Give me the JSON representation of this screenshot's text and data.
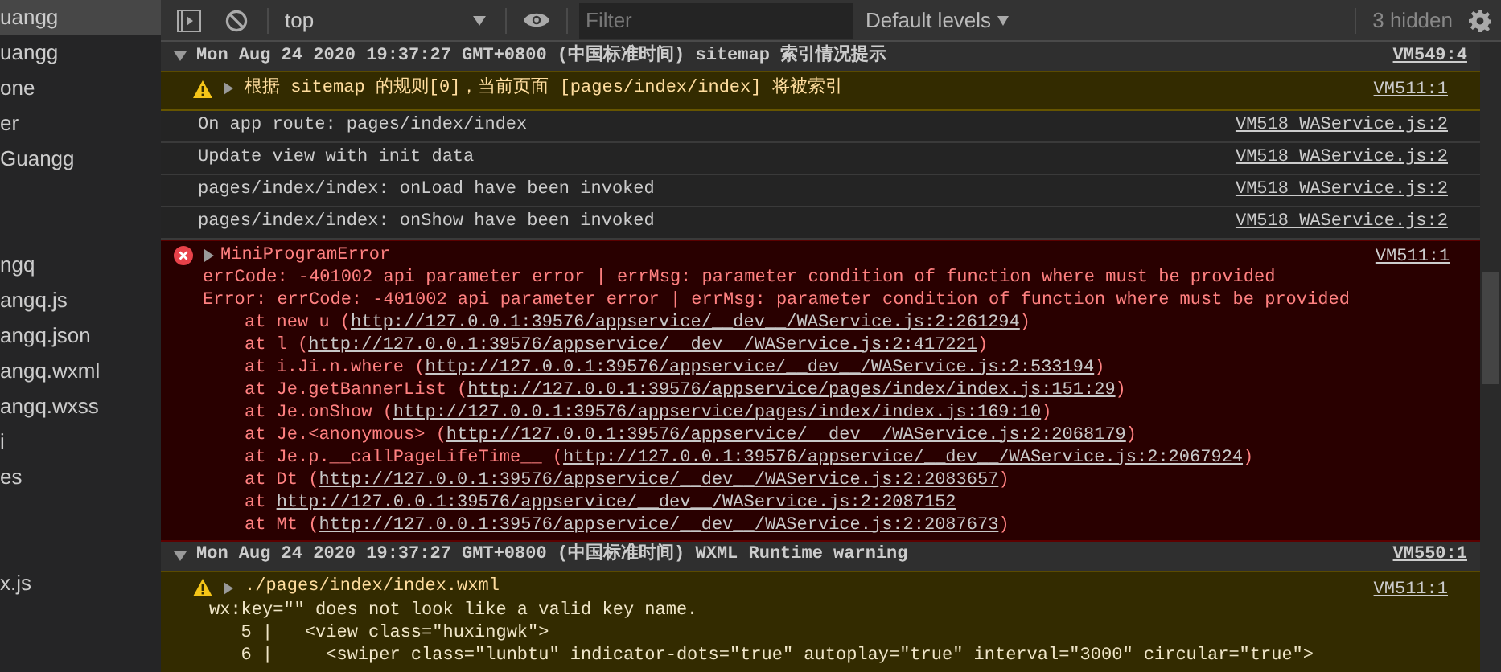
{
  "sidebar": {
    "items": [
      {
        "label": "uangg",
        "selected": true
      },
      {
        "label": "uangg",
        "selected": false
      },
      {
        "label": "one",
        "selected": false
      },
      {
        "label": "er",
        "selected": false
      },
      {
        "label": "Guangg",
        "selected": false
      },
      {
        "label": "ngq",
        "selected": false
      },
      {
        "label": "angq.js",
        "selected": false
      },
      {
        "label": "angq.json",
        "selected": false
      },
      {
        "label": "angq.wxml",
        "selected": false
      },
      {
        "label": "angq.wxss",
        "selected": false
      },
      {
        "label": "i",
        "selected": false
      },
      {
        "label": "es",
        "selected": false
      },
      {
        "label": "x.js",
        "selected": false
      }
    ]
  },
  "toolbar": {
    "context": "top",
    "filter": {
      "placeholder": "Filter"
    },
    "levels": "Default levels",
    "hidden_count": "3 hidden"
  },
  "messages": [
    {
      "kind": "group_header",
      "expanded": true,
      "text": "Mon Aug 24 2020 19:37:27 GMT+0800 (中国标准时间) sitemap 索引情况提示",
      "source": "VM549:4"
    },
    {
      "kind": "warning",
      "expanded": false,
      "text": "根据 sitemap 的规则[0]，当前页面 [pages/index/index] 将被索引",
      "source": "VM511:1"
    },
    {
      "kind": "log",
      "text": "On app route: pages/index/index",
      "source": "VM518 WAService.js:2"
    },
    {
      "kind": "log",
      "text": "Update view with init data",
      "source": "VM518 WAService.js:2"
    },
    {
      "kind": "log",
      "text": "pages/index/index: onLoad have been invoked",
      "source": "VM518 WAService.js:2"
    },
    {
      "kind": "log",
      "text": "pages/index/index: onShow have been invoked",
      "source": "VM518 WAService.js:2"
    },
    {
      "kind": "error",
      "expanded": false,
      "text": "MiniProgramError",
      "source": "VM511:1",
      "lines": [
        "errCode: -401002 api parameter error | errMsg: parameter condition of function where must be provided",
        "Error: errCode: -401002 api parameter error | errMsg: parameter condition of function where must be provided"
      ],
      "stack": [
        {
          "prefix": "at new u (",
          "url": "http://127.0.0.1:39576/appservice/__dev__/WAService.js:2:261294",
          "suffix": ")"
        },
        {
          "prefix": "at l (",
          "url": "http://127.0.0.1:39576/appservice/__dev__/WAService.js:2:417221",
          "suffix": ")"
        },
        {
          "prefix": "at i.Ji.n.where (",
          "url": "http://127.0.0.1:39576/appservice/__dev__/WAService.js:2:533194",
          "suffix": ")"
        },
        {
          "prefix": "at Je.getBannerList (",
          "url": "http://127.0.0.1:39576/appservice/pages/index/index.js:151:29",
          "suffix": ")"
        },
        {
          "prefix": "at Je.onShow (",
          "url": "http://127.0.0.1:39576/appservice/pages/index/index.js:169:10",
          "suffix": ")"
        },
        {
          "prefix": "at Je.<anonymous> (",
          "url": "http://127.0.0.1:39576/appservice/__dev__/WAService.js:2:2068179",
          "suffix": ")"
        },
        {
          "prefix": "at Je.p.__callPageLifeTime__ (",
          "url": "http://127.0.0.1:39576/appservice/__dev__/WAService.js:2:2067924",
          "suffix": ")"
        },
        {
          "prefix": "at Dt (",
          "url": "http://127.0.0.1:39576/appservice/__dev__/WAService.js:2:2083657",
          "suffix": ")"
        },
        {
          "prefix": "at ",
          "url": "http://127.0.0.1:39576/appservice/__dev__/WAService.js:2:2087152"
        },
        {
          "prefix": "at Mt (",
          "url": "http://127.0.0.1:39576/appservice/__dev__/WAService.js:2:2087673",
          "suffix": ")"
        }
      ]
    },
    {
      "kind": "group_header",
      "expanded": true,
      "text": "Mon Aug 24 2020 19:37:27 GMT+0800 (中国标准时间) WXML Runtime warning",
      "source": "VM550:1"
    },
    {
      "kind": "warning",
      "expanded": false,
      "text": "./pages/index/index.wxml",
      "source": "VM511:1",
      "lines": [
        "wx:key=\"\" does not look like a valid key name.",
        "   5 |   <view class=\"huxingwk\">",
        "   6 |     <swiper class=\"lunbtu\" indicator-dots=\"true\" autoplay=\"true\" interval=\"3000\" circular=\"true\">"
      ]
    }
  ]
}
